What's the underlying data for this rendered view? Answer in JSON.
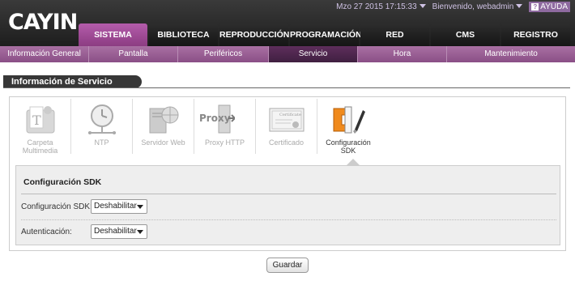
{
  "brand": {
    "logo": "CAYIN"
  },
  "topbar": {
    "datetime": "Mzo 27 2015 17:15:33",
    "welcome": "Bienvenido, webadmin",
    "help": "AYUDA"
  },
  "main_nav": [
    {
      "label": "SISTEMA",
      "active": true
    },
    {
      "label": "BIBLIOTECA"
    },
    {
      "label": "REPRODUCCIÓN"
    },
    {
      "label": "PROGRAMACIÓN"
    },
    {
      "label": "RED"
    },
    {
      "label": "CMS"
    },
    {
      "label": "REGISTRO"
    }
  ],
  "sub_nav": [
    {
      "label": "Información General"
    },
    {
      "label": "Pantalla"
    },
    {
      "label": "Periféricos"
    },
    {
      "label": "Servicio",
      "active": true
    },
    {
      "label": "Hora"
    },
    {
      "label": "Mantenimiento"
    }
  ],
  "page_title": "Información de Servicio",
  "services": [
    {
      "label": "Carpeta Multimedia",
      "icon": "multimedia-folder-icon"
    },
    {
      "label": "NTP",
      "icon": "clock-icon"
    },
    {
      "label": "Servidor Web",
      "icon": "web-server-icon"
    },
    {
      "label": "Proxy HTTP",
      "icon": "proxy-icon",
      "icon_text": "Proxy"
    },
    {
      "label": "Certificado",
      "icon": "certificate-icon",
      "icon_text": "Certificate"
    },
    {
      "label": "Configuración SDK",
      "icon": "sdk-tools-icon",
      "active": true
    }
  ],
  "sdk_config": {
    "title": "Configuración SDK",
    "sdk_label": "Configuración SDK:",
    "sdk_value": "Deshabilitar",
    "auth_label": "Autenticación:",
    "auth_value": "Deshabilitar"
  },
  "save_button": "Guardar",
  "colors": {
    "accent": "#a04c97",
    "subnav": "#9a5f96",
    "active_subnav": "#4a2549"
  }
}
